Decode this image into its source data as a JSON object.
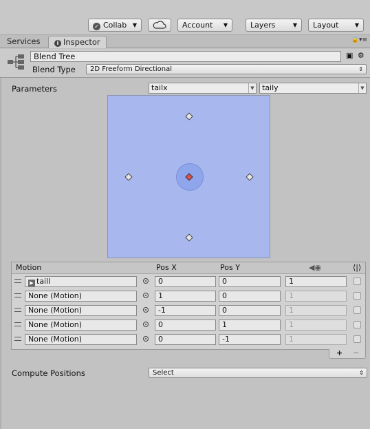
{
  "toolbar": {
    "collab_label": "Collab",
    "account_label": "Account",
    "layers_label": "Layers",
    "layout_label": "Layout"
  },
  "tabs": {
    "services": "Services",
    "inspector": "Inspector"
  },
  "header": {
    "name": "Blend Tree",
    "blend_type_label": "Blend Type",
    "blend_type_value": "2D Freeform Directional"
  },
  "parameters": {
    "label": "Parameters",
    "param_x": "tailx",
    "param_y": "taily"
  },
  "blend_space": {
    "points": [
      {
        "x": 0,
        "y": 0,
        "selected": true
      },
      {
        "x": 1,
        "y": 0
      },
      {
        "x": -1,
        "y": 0
      },
      {
        "x": 0,
        "y": 1
      },
      {
        "x": 0,
        "y": -1
      }
    ],
    "current": {
      "x": 0,
      "y": 0
    }
  },
  "motion_table": {
    "headers": {
      "motion": "Motion",
      "pos_x": "Pos X",
      "pos_y": "Pos Y"
    },
    "rows": [
      {
        "motion": "taill",
        "pos_x": "0",
        "pos_y": "0",
        "speed": "1"
      },
      {
        "motion": "None (Motion)",
        "pos_x": "1",
        "pos_y": "0",
        "speed": "1"
      },
      {
        "motion": "None (Motion)",
        "pos_x": "-1",
        "pos_y": "0",
        "speed": "1"
      },
      {
        "motion": "None (Motion)",
        "pos_x": "0",
        "pos_y": "1",
        "speed": "1"
      },
      {
        "motion": "None (Motion)",
        "pos_x": "0",
        "pos_y": "-1",
        "speed": "1"
      }
    ],
    "add_label": "+",
    "remove_label": "−"
  },
  "compute_positions": {
    "label": "Compute Positions",
    "value": "Select"
  }
}
